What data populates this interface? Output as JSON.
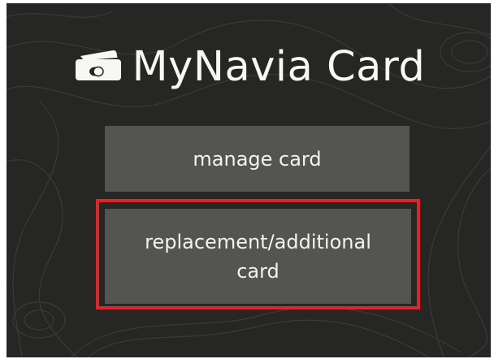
{
  "app": {
    "title": "MyNavia Card",
    "icon": "credit-card-icon"
  },
  "actions": {
    "manage_label": "manage card",
    "replacement_label": "replacement/additional card"
  },
  "colors": {
    "background": "#262624",
    "button": "#545452",
    "text": "#f2f2f0",
    "highlight": "#e2232a"
  }
}
